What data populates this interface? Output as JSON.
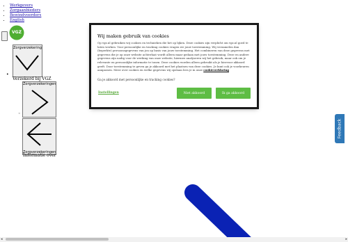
{
  "nav": {
    "top_links": [
      "Werkgevers",
      "Zorgaanbieders",
      "Bewindvoerders",
      "English"
    ]
  },
  "logo": {
    "text": "VGZ",
    "color": "#4fae32"
  },
  "zorgverzekering_label": "Zorgverzekering",
  "verzekerd_text": "Verzekerd bij VGZ",
  "zorgverzekeringen_label_1": "Zorgverzekeringen",
  "zorgverzekeringen_label_2": "Zorgverzekeringen",
  "informatie_text": "Informatie over",
  "feedback_label": "Feedback",
  "cookie": {
    "title": "Wij maken gebruik van cookies",
    "body": "Op vgz.nl gebruiken wij cookies en technieken die het op lijken. Deze cookies zijn verplicht om vgz.nl goed te laten werken. Voor persoonlijke en tracking cookies vragen we jouw toestemming. Wij verzamelen dan (beperkte) persoonsgegevens van jou op basis van jouw toestemming. Het combineren van deze gegevens met gegevens die je op onze website achterlaat wordt alleen maar gedaan met jouw toestemming. Deze en andere gegevens zijn nodig voor de werking van onze website, hiermee analyseren wij het gebruik, maar ook om je relevante en persoonlijke informatie te tonen. Deze cookies worden alleen gebruikt als je hiervoor akkoord geeft. Door toestemming te geven ga je akkoord met het plaatsen van deze cookies. Je kunt ook je voorkeuren aanpassen. Meer over cookies en welke gegevens wij opslaan lees je in onze",
    "link": "cookieverklaring",
    "optional_line": "Ga je akkoord met persoonlijke en tracking cookies?",
    "instellingen": "Instellingen",
    "niet_akkoord": "Niet akkoord",
    "akkoord": "Ik ga akkoord",
    "button_color": "#5ebd44"
  }
}
